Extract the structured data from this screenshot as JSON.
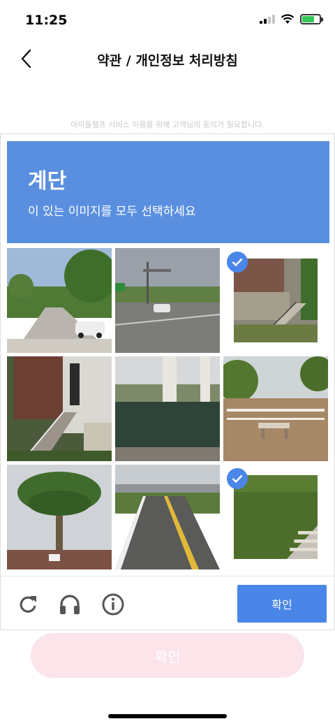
{
  "status_bar": {
    "time": "11:25",
    "battery_color": "#34c759",
    "icons": [
      "signal-icon",
      "wifi-icon",
      "battery-charging-icon"
    ]
  },
  "nav": {
    "title": "약관 / 개인정보 처리방침",
    "back_icon": "chevron-left-icon"
  },
  "consent_text": "아이돌챔프 서비스 이용을 위해 고객님의 동의가 필요합니다.",
  "captcha": {
    "prompt_color": "#5a8fe0",
    "prompt_title": "계단",
    "prompt_subtitle": "이 있는 이미지를 모두 선택하세요",
    "tiles": [
      {
        "scene": "residential-street-with-car",
        "selected": false
      },
      {
        "scene": "highway-intersection",
        "selected": false
      },
      {
        "scene": "house-with-concrete-stairs",
        "selected": true
      },
      {
        "scene": "porch-with-wooden-stairs",
        "selected": false
      },
      {
        "scene": "bridge-pillars-fence",
        "selected": false
      },
      {
        "scene": "sidewalk-with-railing",
        "selected": false
      },
      {
        "scene": "palm-tree",
        "selected": false
      },
      {
        "scene": "two-lane-road-overpass",
        "selected": false
      },
      {
        "scene": "grassy-slope-with-steps",
        "selected": true
      }
    ],
    "tools": [
      "reload-icon",
      "headphones-icon",
      "info-icon"
    ],
    "verify_label": "확인",
    "accent": "#4a86e8"
  },
  "confirm_label": "확인",
  "confirm_color": "#fbe4ea"
}
